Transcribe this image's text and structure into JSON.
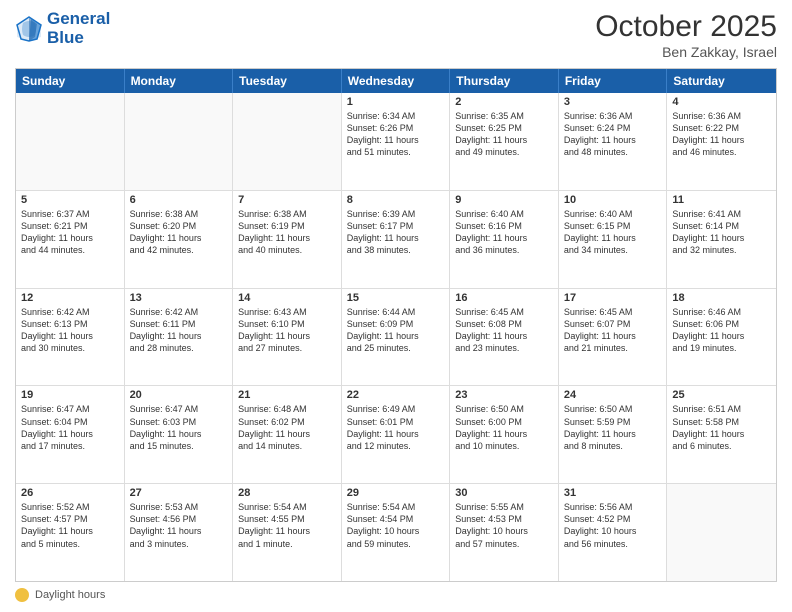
{
  "header": {
    "logo_line1": "General",
    "logo_line2": "Blue",
    "month": "October 2025",
    "location": "Ben Zakkay, Israel"
  },
  "footer": {
    "label": "Daylight hours"
  },
  "weekdays": [
    "Sunday",
    "Monday",
    "Tuesday",
    "Wednesday",
    "Thursday",
    "Friday",
    "Saturday"
  ],
  "rows": [
    [
      {
        "day": "",
        "text": ""
      },
      {
        "day": "",
        "text": ""
      },
      {
        "day": "",
        "text": ""
      },
      {
        "day": "1",
        "text": "Sunrise: 6:34 AM\nSunset: 6:26 PM\nDaylight: 11 hours\nand 51 minutes."
      },
      {
        "day": "2",
        "text": "Sunrise: 6:35 AM\nSunset: 6:25 PM\nDaylight: 11 hours\nand 49 minutes."
      },
      {
        "day": "3",
        "text": "Sunrise: 6:36 AM\nSunset: 6:24 PM\nDaylight: 11 hours\nand 48 minutes."
      },
      {
        "day": "4",
        "text": "Sunrise: 6:36 AM\nSunset: 6:22 PM\nDaylight: 11 hours\nand 46 minutes."
      }
    ],
    [
      {
        "day": "5",
        "text": "Sunrise: 6:37 AM\nSunset: 6:21 PM\nDaylight: 11 hours\nand 44 minutes."
      },
      {
        "day": "6",
        "text": "Sunrise: 6:38 AM\nSunset: 6:20 PM\nDaylight: 11 hours\nand 42 minutes."
      },
      {
        "day": "7",
        "text": "Sunrise: 6:38 AM\nSunset: 6:19 PM\nDaylight: 11 hours\nand 40 minutes."
      },
      {
        "day": "8",
        "text": "Sunrise: 6:39 AM\nSunset: 6:17 PM\nDaylight: 11 hours\nand 38 minutes."
      },
      {
        "day": "9",
        "text": "Sunrise: 6:40 AM\nSunset: 6:16 PM\nDaylight: 11 hours\nand 36 minutes."
      },
      {
        "day": "10",
        "text": "Sunrise: 6:40 AM\nSunset: 6:15 PM\nDaylight: 11 hours\nand 34 minutes."
      },
      {
        "day": "11",
        "text": "Sunrise: 6:41 AM\nSunset: 6:14 PM\nDaylight: 11 hours\nand 32 minutes."
      }
    ],
    [
      {
        "day": "12",
        "text": "Sunrise: 6:42 AM\nSunset: 6:13 PM\nDaylight: 11 hours\nand 30 minutes."
      },
      {
        "day": "13",
        "text": "Sunrise: 6:42 AM\nSunset: 6:11 PM\nDaylight: 11 hours\nand 28 minutes."
      },
      {
        "day": "14",
        "text": "Sunrise: 6:43 AM\nSunset: 6:10 PM\nDaylight: 11 hours\nand 27 minutes."
      },
      {
        "day": "15",
        "text": "Sunrise: 6:44 AM\nSunset: 6:09 PM\nDaylight: 11 hours\nand 25 minutes."
      },
      {
        "day": "16",
        "text": "Sunrise: 6:45 AM\nSunset: 6:08 PM\nDaylight: 11 hours\nand 23 minutes."
      },
      {
        "day": "17",
        "text": "Sunrise: 6:45 AM\nSunset: 6:07 PM\nDaylight: 11 hours\nand 21 minutes."
      },
      {
        "day": "18",
        "text": "Sunrise: 6:46 AM\nSunset: 6:06 PM\nDaylight: 11 hours\nand 19 minutes."
      }
    ],
    [
      {
        "day": "19",
        "text": "Sunrise: 6:47 AM\nSunset: 6:04 PM\nDaylight: 11 hours\nand 17 minutes."
      },
      {
        "day": "20",
        "text": "Sunrise: 6:47 AM\nSunset: 6:03 PM\nDaylight: 11 hours\nand 15 minutes."
      },
      {
        "day": "21",
        "text": "Sunrise: 6:48 AM\nSunset: 6:02 PM\nDaylight: 11 hours\nand 14 minutes."
      },
      {
        "day": "22",
        "text": "Sunrise: 6:49 AM\nSunset: 6:01 PM\nDaylight: 11 hours\nand 12 minutes."
      },
      {
        "day": "23",
        "text": "Sunrise: 6:50 AM\nSunset: 6:00 PM\nDaylight: 11 hours\nand 10 minutes."
      },
      {
        "day": "24",
        "text": "Sunrise: 6:50 AM\nSunset: 5:59 PM\nDaylight: 11 hours\nand 8 minutes."
      },
      {
        "day": "25",
        "text": "Sunrise: 6:51 AM\nSunset: 5:58 PM\nDaylight: 11 hours\nand 6 minutes."
      }
    ],
    [
      {
        "day": "26",
        "text": "Sunrise: 5:52 AM\nSunset: 4:57 PM\nDaylight: 11 hours\nand 5 minutes."
      },
      {
        "day": "27",
        "text": "Sunrise: 5:53 AM\nSunset: 4:56 PM\nDaylight: 11 hours\nand 3 minutes."
      },
      {
        "day": "28",
        "text": "Sunrise: 5:54 AM\nSunset: 4:55 PM\nDaylight: 11 hours\nand 1 minute."
      },
      {
        "day": "29",
        "text": "Sunrise: 5:54 AM\nSunset: 4:54 PM\nDaylight: 10 hours\nand 59 minutes."
      },
      {
        "day": "30",
        "text": "Sunrise: 5:55 AM\nSunset: 4:53 PM\nDaylight: 10 hours\nand 57 minutes."
      },
      {
        "day": "31",
        "text": "Sunrise: 5:56 AM\nSunset: 4:52 PM\nDaylight: 10 hours\nand 56 minutes."
      },
      {
        "day": "",
        "text": ""
      }
    ]
  ]
}
